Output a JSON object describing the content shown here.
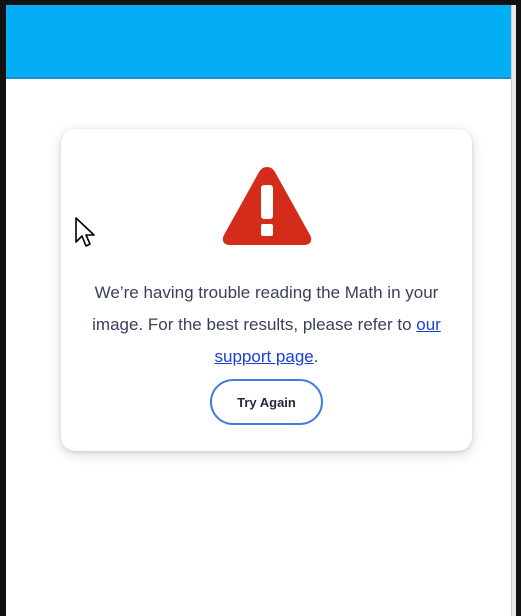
{
  "error_card": {
    "message_part1": "We’re having trouble reading the Math in your image. For the best results, please refer to ",
    "link_text": "our support page",
    "message_part2": ".",
    "button_label": "Try Again"
  },
  "colors": {
    "topbar": "#03aef5",
    "warning": "#d42c1b",
    "link": "#1a3fd8",
    "button_border": "#3f7ee0"
  },
  "icons": {
    "warning": "warning-triangle-icon",
    "cursor": "mouse-pointer-icon"
  }
}
